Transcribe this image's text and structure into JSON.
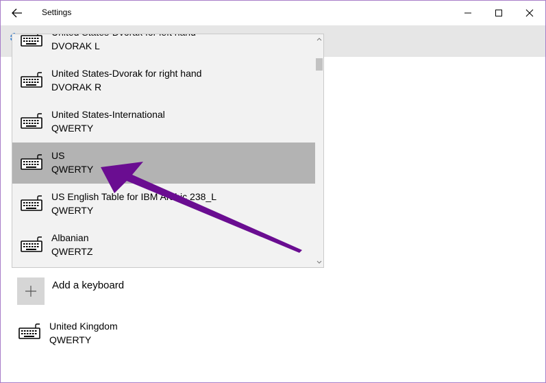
{
  "window": {
    "title": "Settings",
    "controls": [
      "minimize-icon",
      "maximize-icon",
      "close-icon"
    ]
  },
  "keyboard_list": {
    "items": [
      {
        "name": "United States-Dvorak for left hand",
        "layout": "DVORAK L",
        "icon": "keyboard-icon"
      },
      {
        "name": "United States-Dvorak for right hand",
        "layout": "DVORAK R",
        "icon": "keyboard-icon"
      },
      {
        "name": "United States-International",
        "layout": "QWERTY",
        "icon": "keyboard-icon"
      },
      {
        "name": "US",
        "layout": "QWERTY",
        "icon": "keyboard-icon",
        "selected": true
      },
      {
        "name": "US English Table for IBM Arabic 238_L",
        "layout": "QWERTY",
        "icon": "keyboard-icon"
      },
      {
        "name": "Albanian",
        "layout": "QWERTZ",
        "icon": "keyboard-icon"
      }
    ]
  },
  "add_keyboard": {
    "label": "Add a keyboard",
    "icon": "plus-icon"
  },
  "installed_keyboards": [
    {
      "name": "United Kingdom",
      "layout": "QWERTY",
      "icon": "keyboard-icon"
    }
  ],
  "annotation": {
    "type": "arrow",
    "color": "#6a0d91"
  },
  "colors": {
    "selected_row": "#b3b3b3",
    "dropdown_bg": "#f2f2f2",
    "header_band": "#e6e6e6",
    "window_border": "#a77cc8"
  }
}
